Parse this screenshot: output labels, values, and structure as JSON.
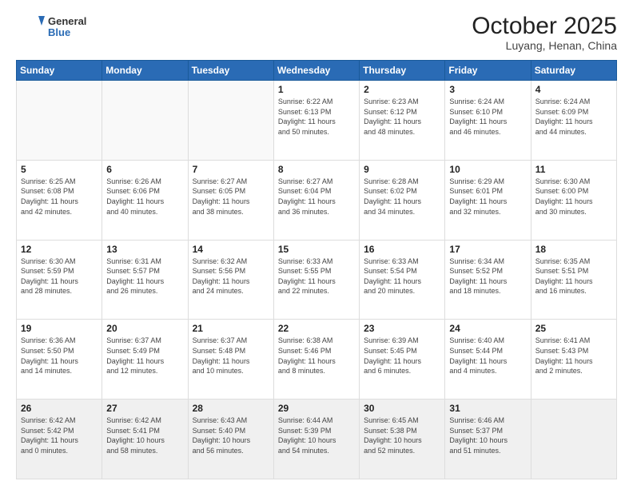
{
  "header": {
    "logo_general": "General",
    "logo_blue": "Blue",
    "title": "October 2025",
    "subtitle": "Luyang, Henan, China"
  },
  "days_of_week": [
    "Sunday",
    "Monday",
    "Tuesday",
    "Wednesday",
    "Thursday",
    "Friday",
    "Saturday"
  ],
  "weeks": [
    [
      {
        "day": "",
        "info": ""
      },
      {
        "day": "",
        "info": ""
      },
      {
        "day": "",
        "info": ""
      },
      {
        "day": "1",
        "info": "Sunrise: 6:22 AM\nSunset: 6:13 PM\nDaylight: 11 hours\nand 50 minutes."
      },
      {
        "day": "2",
        "info": "Sunrise: 6:23 AM\nSunset: 6:12 PM\nDaylight: 11 hours\nand 48 minutes."
      },
      {
        "day": "3",
        "info": "Sunrise: 6:24 AM\nSunset: 6:10 PM\nDaylight: 11 hours\nand 46 minutes."
      },
      {
        "day": "4",
        "info": "Sunrise: 6:24 AM\nSunset: 6:09 PM\nDaylight: 11 hours\nand 44 minutes."
      }
    ],
    [
      {
        "day": "5",
        "info": "Sunrise: 6:25 AM\nSunset: 6:08 PM\nDaylight: 11 hours\nand 42 minutes."
      },
      {
        "day": "6",
        "info": "Sunrise: 6:26 AM\nSunset: 6:06 PM\nDaylight: 11 hours\nand 40 minutes."
      },
      {
        "day": "7",
        "info": "Sunrise: 6:27 AM\nSunset: 6:05 PM\nDaylight: 11 hours\nand 38 minutes."
      },
      {
        "day": "8",
        "info": "Sunrise: 6:27 AM\nSunset: 6:04 PM\nDaylight: 11 hours\nand 36 minutes."
      },
      {
        "day": "9",
        "info": "Sunrise: 6:28 AM\nSunset: 6:02 PM\nDaylight: 11 hours\nand 34 minutes."
      },
      {
        "day": "10",
        "info": "Sunrise: 6:29 AM\nSunset: 6:01 PM\nDaylight: 11 hours\nand 32 minutes."
      },
      {
        "day": "11",
        "info": "Sunrise: 6:30 AM\nSunset: 6:00 PM\nDaylight: 11 hours\nand 30 minutes."
      }
    ],
    [
      {
        "day": "12",
        "info": "Sunrise: 6:30 AM\nSunset: 5:59 PM\nDaylight: 11 hours\nand 28 minutes."
      },
      {
        "day": "13",
        "info": "Sunrise: 6:31 AM\nSunset: 5:57 PM\nDaylight: 11 hours\nand 26 minutes."
      },
      {
        "day": "14",
        "info": "Sunrise: 6:32 AM\nSunset: 5:56 PM\nDaylight: 11 hours\nand 24 minutes."
      },
      {
        "day": "15",
        "info": "Sunrise: 6:33 AM\nSunset: 5:55 PM\nDaylight: 11 hours\nand 22 minutes."
      },
      {
        "day": "16",
        "info": "Sunrise: 6:33 AM\nSunset: 5:54 PM\nDaylight: 11 hours\nand 20 minutes."
      },
      {
        "day": "17",
        "info": "Sunrise: 6:34 AM\nSunset: 5:52 PM\nDaylight: 11 hours\nand 18 minutes."
      },
      {
        "day": "18",
        "info": "Sunrise: 6:35 AM\nSunset: 5:51 PM\nDaylight: 11 hours\nand 16 minutes."
      }
    ],
    [
      {
        "day": "19",
        "info": "Sunrise: 6:36 AM\nSunset: 5:50 PM\nDaylight: 11 hours\nand 14 minutes."
      },
      {
        "day": "20",
        "info": "Sunrise: 6:37 AM\nSunset: 5:49 PM\nDaylight: 11 hours\nand 12 minutes."
      },
      {
        "day": "21",
        "info": "Sunrise: 6:37 AM\nSunset: 5:48 PM\nDaylight: 11 hours\nand 10 minutes."
      },
      {
        "day": "22",
        "info": "Sunrise: 6:38 AM\nSunset: 5:46 PM\nDaylight: 11 hours\nand 8 minutes."
      },
      {
        "day": "23",
        "info": "Sunrise: 6:39 AM\nSunset: 5:45 PM\nDaylight: 11 hours\nand 6 minutes."
      },
      {
        "day": "24",
        "info": "Sunrise: 6:40 AM\nSunset: 5:44 PM\nDaylight: 11 hours\nand 4 minutes."
      },
      {
        "day": "25",
        "info": "Sunrise: 6:41 AM\nSunset: 5:43 PM\nDaylight: 11 hours\nand 2 minutes."
      }
    ],
    [
      {
        "day": "26",
        "info": "Sunrise: 6:42 AM\nSunset: 5:42 PM\nDaylight: 11 hours\nand 0 minutes."
      },
      {
        "day": "27",
        "info": "Sunrise: 6:42 AM\nSunset: 5:41 PM\nDaylight: 10 hours\nand 58 minutes."
      },
      {
        "day": "28",
        "info": "Sunrise: 6:43 AM\nSunset: 5:40 PM\nDaylight: 10 hours\nand 56 minutes."
      },
      {
        "day": "29",
        "info": "Sunrise: 6:44 AM\nSunset: 5:39 PM\nDaylight: 10 hours\nand 54 minutes."
      },
      {
        "day": "30",
        "info": "Sunrise: 6:45 AM\nSunset: 5:38 PM\nDaylight: 10 hours\nand 52 minutes."
      },
      {
        "day": "31",
        "info": "Sunrise: 6:46 AM\nSunset: 5:37 PM\nDaylight: 10 hours\nand 51 minutes."
      },
      {
        "day": "",
        "info": ""
      }
    ]
  ]
}
